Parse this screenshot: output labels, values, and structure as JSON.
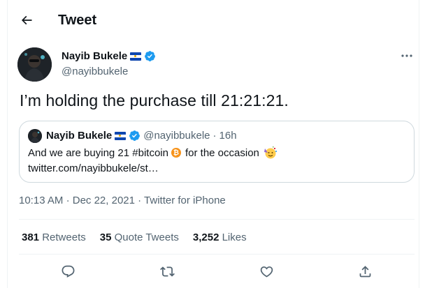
{
  "header": {
    "title": "Tweet",
    "back_icon": "arrow-left-icon"
  },
  "tweet": {
    "author_name": "Nayib Bukele",
    "author_handle": "@nayibbukele",
    "text": "I’m holding the purchase till 21:21:21.",
    "time": "10:13 AM",
    "sep1": "·",
    "date": "Dec 22, 2021",
    "sep2": "·",
    "source": "Twitter for iPhone"
  },
  "quote": {
    "author_name": "Nayib Bukele",
    "author_handle": "@nayibbukele",
    "sep": "·",
    "age": "16h",
    "text_before": "And we are buying 21 #bitcoin",
    "text_after": "for the occasion",
    "link": "twitter.com/nayibbukele/st…"
  },
  "stats": {
    "retweets_count": "381",
    "retweets_label": "Retweets",
    "quotes_count": "35",
    "quotes_label": "Quote Tweets",
    "likes_count": "3,252",
    "likes_label": "Likes"
  },
  "colors": {
    "accent": "#1d9bf0",
    "text": "#0f1419",
    "secondary": "#536471",
    "border": "#cfd9de",
    "divider": "#eff3f4"
  },
  "icons": {
    "reply": "reply-icon",
    "retweet": "retweet-icon",
    "like": "like-icon",
    "share": "share-icon",
    "more": "more-icon",
    "verified": "verified-badge-icon",
    "flag": "el-salvador-flag-icon",
    "bitcoin": "bitcoin-icon",
    "party": "party-face-icon"
  }
}
